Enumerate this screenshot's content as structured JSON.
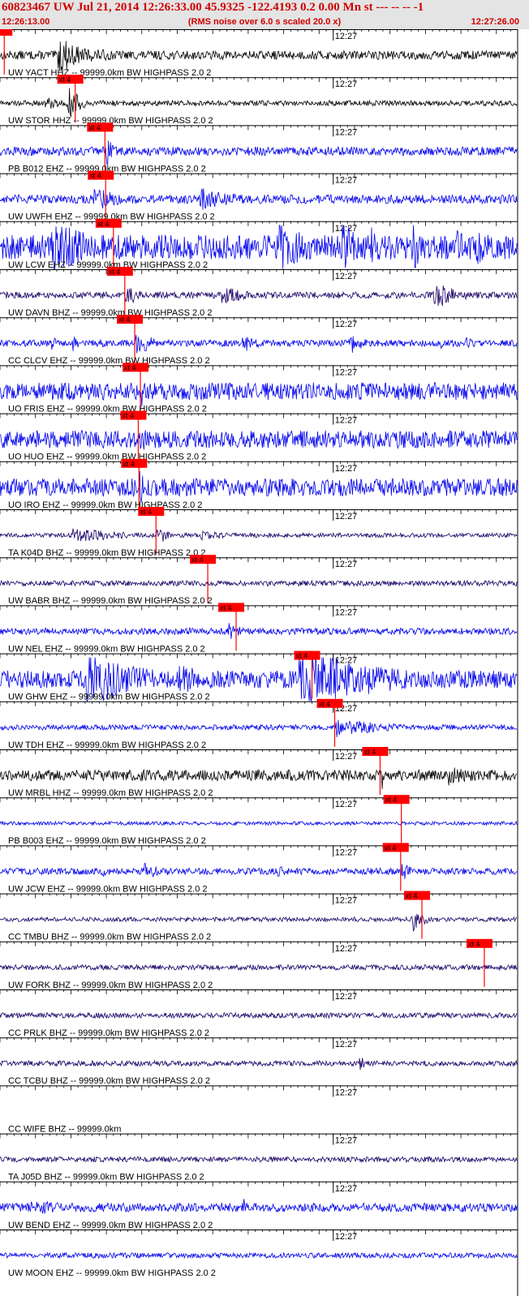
{
  "header": {
    "title": "60823467 UW Jul 21, 2014 12:26:33.00   45.9325 -122.4193  0.2 0.00 Mn st --- -- --   -1",
    "start_time": "12:26:13.00",
    "end_time": "12:27:26.00",
    "subtitle": "(RMS noise over 6.0 s scaled 20.0 x)"
  },
  "colors": {
    "header_text": "#d00000",
    "pick": "#ff0000",
    "label_text": "#000000",
    "trace_blue": "#0000ee",
    "trace_navy": "#1a0066",
    "trace_black": "#000000"
  },
  "chart_data": {
    "type": "line",
    "x_unit": "seconds after 12:26:13.00",
    "xlim": [
      0,
      73
    ],
    "minute_tick_label": "12:27",
    "minute_tick_time": 47,
    "pick_label": "xt 4",
    "series": [
      {
        "name": "UW YACT HHZ -- 99999.0km BW  HIGHPASS  2.0  2",
        "color": "trace_black",
        "pick": 0.6,
        "base": 0.2,
        "bursts": [
          [
            8,
            24,
            1.0,
            1.5
          ]
        ],
        "clip": false
      },
      {
        "name": "UW STOR HHZ -- 99999.0km BW  HIGHPASS  2.0  2",
        "color": "trace_black",
        "pick": 10.6,
        "base": 0.12,
        "bursts": [
          [
            6,
            24,
            0.35,
            2.0
          ],
          [
            9.5,
            12,
            0.9,
            0.8
          ]
        ],
        "clip": false
      },
      {
        "name": "PB B012 EHZ -- 99999.0km BW  HIGHPASS  2.0  2",
        "color": "trace_blue",
        "pick": 14.8,
        "base": 0.2,
        "bursts": [
          [
            14.8,
            16,
            0.8,
            0.6
          ]
        ],
        "clip": false
      },
      {
        "name": "UW UWFH EHZ -- 99999.0km BW  HIGHPASS  2.0  2",
        "color": "trace_blue",
        "pick": 14.9,
        "base": 0.2,
        "bursts": [
          [
            13,
            20,
            0.6,
            2.0
          ],
          [
            28,
            42,
            0.55,
            3.0
          ]
        ],
        "clip": false
      },
      {
        "name": "UW LCW EHZ -- 99999.0km BW  HIGHPASS  2.0  2",
        "color": "trace_blue",
        "pick": 16.0,
        "base": 0.35,
        "bursts": [
          [
            7,
            33,
            0.9,
            3.0
          ],
          [
            39,
            47,
            0.9,
            2.0
          ],
          [
            48,
            52,
            1.0,
            1.0
          ],
          [
            52,
            57,
            0.7,
            1.0
          ],
          [
            58,
            64,
            1.0,
            0.6
          ],
          [
            64,
            67,
            0.7,
            1.0
          ],
          [
            67,
            73,
            0.95,
            0.5
          ]
        ],
        "clip": true
      },
      {
        "name": "UW DAVN BHZ -- 99999.0km BW  HIGHPASS  2.0  2",
        "color": "trace_navy",
        "pick": 17.6,
        "base": 0.15,
        "bursts": [
          [
            17.6,
            20,
            0.6,
            1.0
          ],
          [
            31,
            40,
            0.45,
            2.0
          ],
          [
            61,
            66,
            0.75,
            1.5
          ]
        ],
        "clip": false
      },
      {
        "name": "CC CLCV EHZ -- 99999.0km BW  HIGHPASS  2.0  2",
        "color": "trace_blue",
        "pick": 19.0,
        "base": 0.15,
        "bursts": [
          [
            7,
            8,
            0.55,
            0.5
          ],
          [
            10,
            11,
            0.5,
            0.5
          ],
          [
            13.5,
            14.5,
            0.45,
            0.5
          ],
          [
            19,
            23,
            0.75,
            1.0
          ],
          [
            34,
            38,
            0.55,
            1.0
          ],
          [
            49,
            53,
            0.6,
            1.0
          ],
          [
            62,
            63,
            0.4,
            0.5
          ],
          [
            65.5,
            67,
            0.5,
            0.5
          ]
        ],
        "clip": false
      },
      {
        "name": "UO FRIS EHZ -- 99999.0km BW  HIGHPASS  2.0  2",
        "color": "trace_blue",
        "pick": 19.8,
        "base": 0.25,
        "bursts": [
          [
            19.5,
            22.5,
            1.0,
            0.3
          ]
        ],
        "clip": true
      },
      {
        "name": "UO HUO EHZ -- 99999.0km BW  HIGHPASS  2.0  2",
        "color": "trace_blue",
        "pick": 19.5,
        "base": 0.25,
        "bursts": [
          [
            19.5,
            22.5,
            1.0,
            0.3
          ]
        ],
        "clip": true
      },
      {
        "name": "UO IRO EHZ -- 99999.0km BW  HIGHPASS  2.0  2",
        "color": "trace_blue",
        "pick": 19.6,
        "base": 0.25,
        "bursts": [
          [
            19.5,
            22.5,
            1.0,
            0.3
          ]
        ],
        "clip": true
      },
      {
        "name": "TA K04D BHZ -- 99999.0km BW  HIGHPASS  2.0  2",
        "color": "trace_navy",
        "pick": 22.0,
        "base": 0.1,
        "bursts": [
          [
            10,
            30,
            0.35,
            4.0
          ],
          [
            22,
            24,
            0.6,
            0.8
          ],
          [
            28,
            38,
            0.25,
            3.0
          ]
        ],
        "clip": false
      },
      {
        "name": "UW BABR BHZ -- 99999.0km BW  HIGHPASS  2.0  2",
        "color": "trace_navy",
        "pick": 29.3,
        "base": 0.12,
        "bursts": [],
        "clip": false
      },
      {
        "name": "UW NEL EHZ -- 99999.0km BW  HIGHPASS  2.0  2",
        "color": "trace_blue",
        "pick": 33.3,
        "base": 0.15,
        "bursts": [
          [
            32,
            35,
            0.55,
            0.8
          ],
          [
            56,
            57,
            0.25,
            0.5
          ],
          [
            61,
            62,
            0.2,
            0.5
          ],
          [
            66,
            67,
            0.3,
            0.5
          ]
        ],
        "clip": false
      },
      {
        "name": "UW GHW EHZ -- 99999.0km BW  HIGHPASS  2.0  2",
        "color": "trace_blue",
        "pick": 44.0,
        "base": 0.25,
        "bursts": [
          [
            12,
            22,
            0.85,
            4.0
          ],
          [
            25,
            33,
            0.45,
            3.0
          ],
          [
            42,
            73,
            0.9,
            6.0
          ]
        ],
        "clip": true
      },
      {
        "name": "UW TDH EHZ -- 99999.0km BW  HIGHPASS  2.0  2",
        "color": "trace_blue",
        "pick": 47.2,
        "base": 0.12,
        "bursts": [
          [
            47.2,
            49,
            0.55,
            0.8
          ],
          [
            49,
            58,
            0.4,
            3.0
          ]
        ],
        "clip": false
      },
      {
        "name": "UW MRBL HHZ -- 99999.0km BW  HIGHPASS  2.0  2",
        "color": "trace_black",
        "pick": 53.6,
        "base": 0.25,
        "bursts": [
          [
            53.6,
            55,
            0.8,
            0.6
          ],
          [
            63,
            71,
            0.5,
            2.5
          ]
        ],
        "clip": false
      },
      {
        "name": "PB B003 EHZ -- 99999.0km BW  HIGHPASS  2.0  2",
        "color": "trace_blue",
        "pick": 56.6,
        "base": 0.08,
        "bursts": [],
        "clip": false
      },
      {
        "name": "UW JCW EHZ -- 99999.0km BW  HIGHPASS  2.0  2",
        "color": "trace_blue",
        "pick": 56.5,
        "base": 0.15,
        "bursts": [
          [
            14,
            15,
            0.45,
            0.4
          ],
          [
            20,
            27,
            0.4,
            2.0
          ],
          [
            39,
            40,
            0.5,
            0.4
          ],
          [
            56.5,
            58,
            0.6,
            0.6
          ]
        ],
        "clip": false
      },
      {
        "name": "CC TMBU BHZ -- 99999.0km BW  HIGHPASS  2.0  2",
        "color": "trace_navy",
        "pick": 59.5,
        "base": 0.1,
        "bursts": [
          [
            58,
            60.5,
            0.75,
            0.7
          ]
        ],
        "clip": false
      },
      {
        "name": "UW FORK BHZ -- 99999.0km BW  HIGHPASS  2.0  2",
        "color": "trace_navy",
        "pick": 68.3,
        "base": 0.12,
        "bursts": [],
        "clip": false
      },
      {
        "name": "CC PRLK BHZ -- 99999.0km BW  HIGHPASS  2.0  2",
        "color": "trace_navy",
        "pick": null,
        "base": 0.12,
        "bursts": [],
        "clip": false
      },
      {
        "name": "CC TCBU BHZ -- 99999.0km BW  HIGHPASS  2.0  2",
        "color": "trace_navy",
        "pick": null,
        "base": 0.12,
        "bursts": [
          [
            50.5,
            51.5,
            0.5,
            0.4
          ]
        ],
        "clip": false
      },
      {
        "name": "CC WIFE BHZ -- 99999.0km",
        "color": "trace_navy",
        "pick": null,
        "base": 0.0,
        "bursts": [],
        "clip": false
      },
      {
        "name": "TA J05D BHZ -- 99999.0km BW  HIGHPASS  2.0  2",
        "color": "trace_navy",
        "pick": null,
        "base": 0.12,
        "bursts": [],
        "clip": false
      },
      {
        "name": "UW BEND EHZ -- 99999.0km BW  HIGHPASS  2.0  2",
        "color": "trace_blue",
        "pick": null,
        "base": 0.2,
        "bursts": [
          [
            4,
            72,
            0.4,
            3.0
          ],
          [
            34,
            36,
            0.6,
            0.5
          ]
        ],
        "clip": false
      },
      {
        "name": "UW MOON EHZ -- 99999.0km BW  HIGHPASS  2.0  2",
        "color": "trace_blue",
        "pick": null,
        "base": 0.12,
        "bursts": [],
        "clip": false
      }
    ]
  }
}
